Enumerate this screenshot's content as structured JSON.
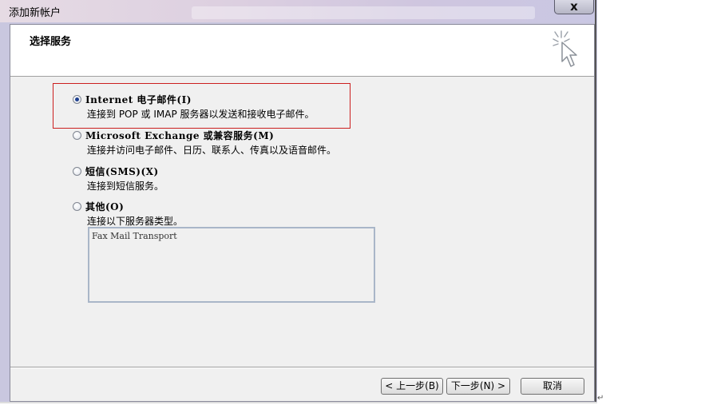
{
  "window": {
    "title": "添加新帐户",
    "close_label": "x"
  },
  "header": {
    "title": "选择服务",
    "icon": "cursor-sparkle-icon"
  },
  "options": [
    {
      "label": "Internet 电子邮件(I)",
      "description": "连接到 POP 或 IMAP 服务器以发送和接收电子邮件。",
      "checked": true
    },
    {
      "label": "Microsoft Exchange 或兼容服务(M)",
      "description": "连接并访问电子邮件、日历、联系人、传真以及语音邮件。",
      "checked": false
    },
    {
      "label": "短信(SMS)(X)",
      "description": "连接到短信服务。",
      "checked": false
    },
    {
      "label": "其他(O)",
      "description": "连接以下服务器类型。",
      "checked": false
    }
  ],
  "other_list": {
    "items": [
      "Fax Mail Transport"
    ]
  },
  "buttons": {
    "back": "< 上一步(B)",
    "next": "下一步(N) >",
    "cancel": "取消"
  },
  "colors": {
    "highlight_border": "#cc1f1f",
    "radio_dot": "#1d3f8f"
  },
  "misc": {
    "return_mark": "↵"
  }
}
